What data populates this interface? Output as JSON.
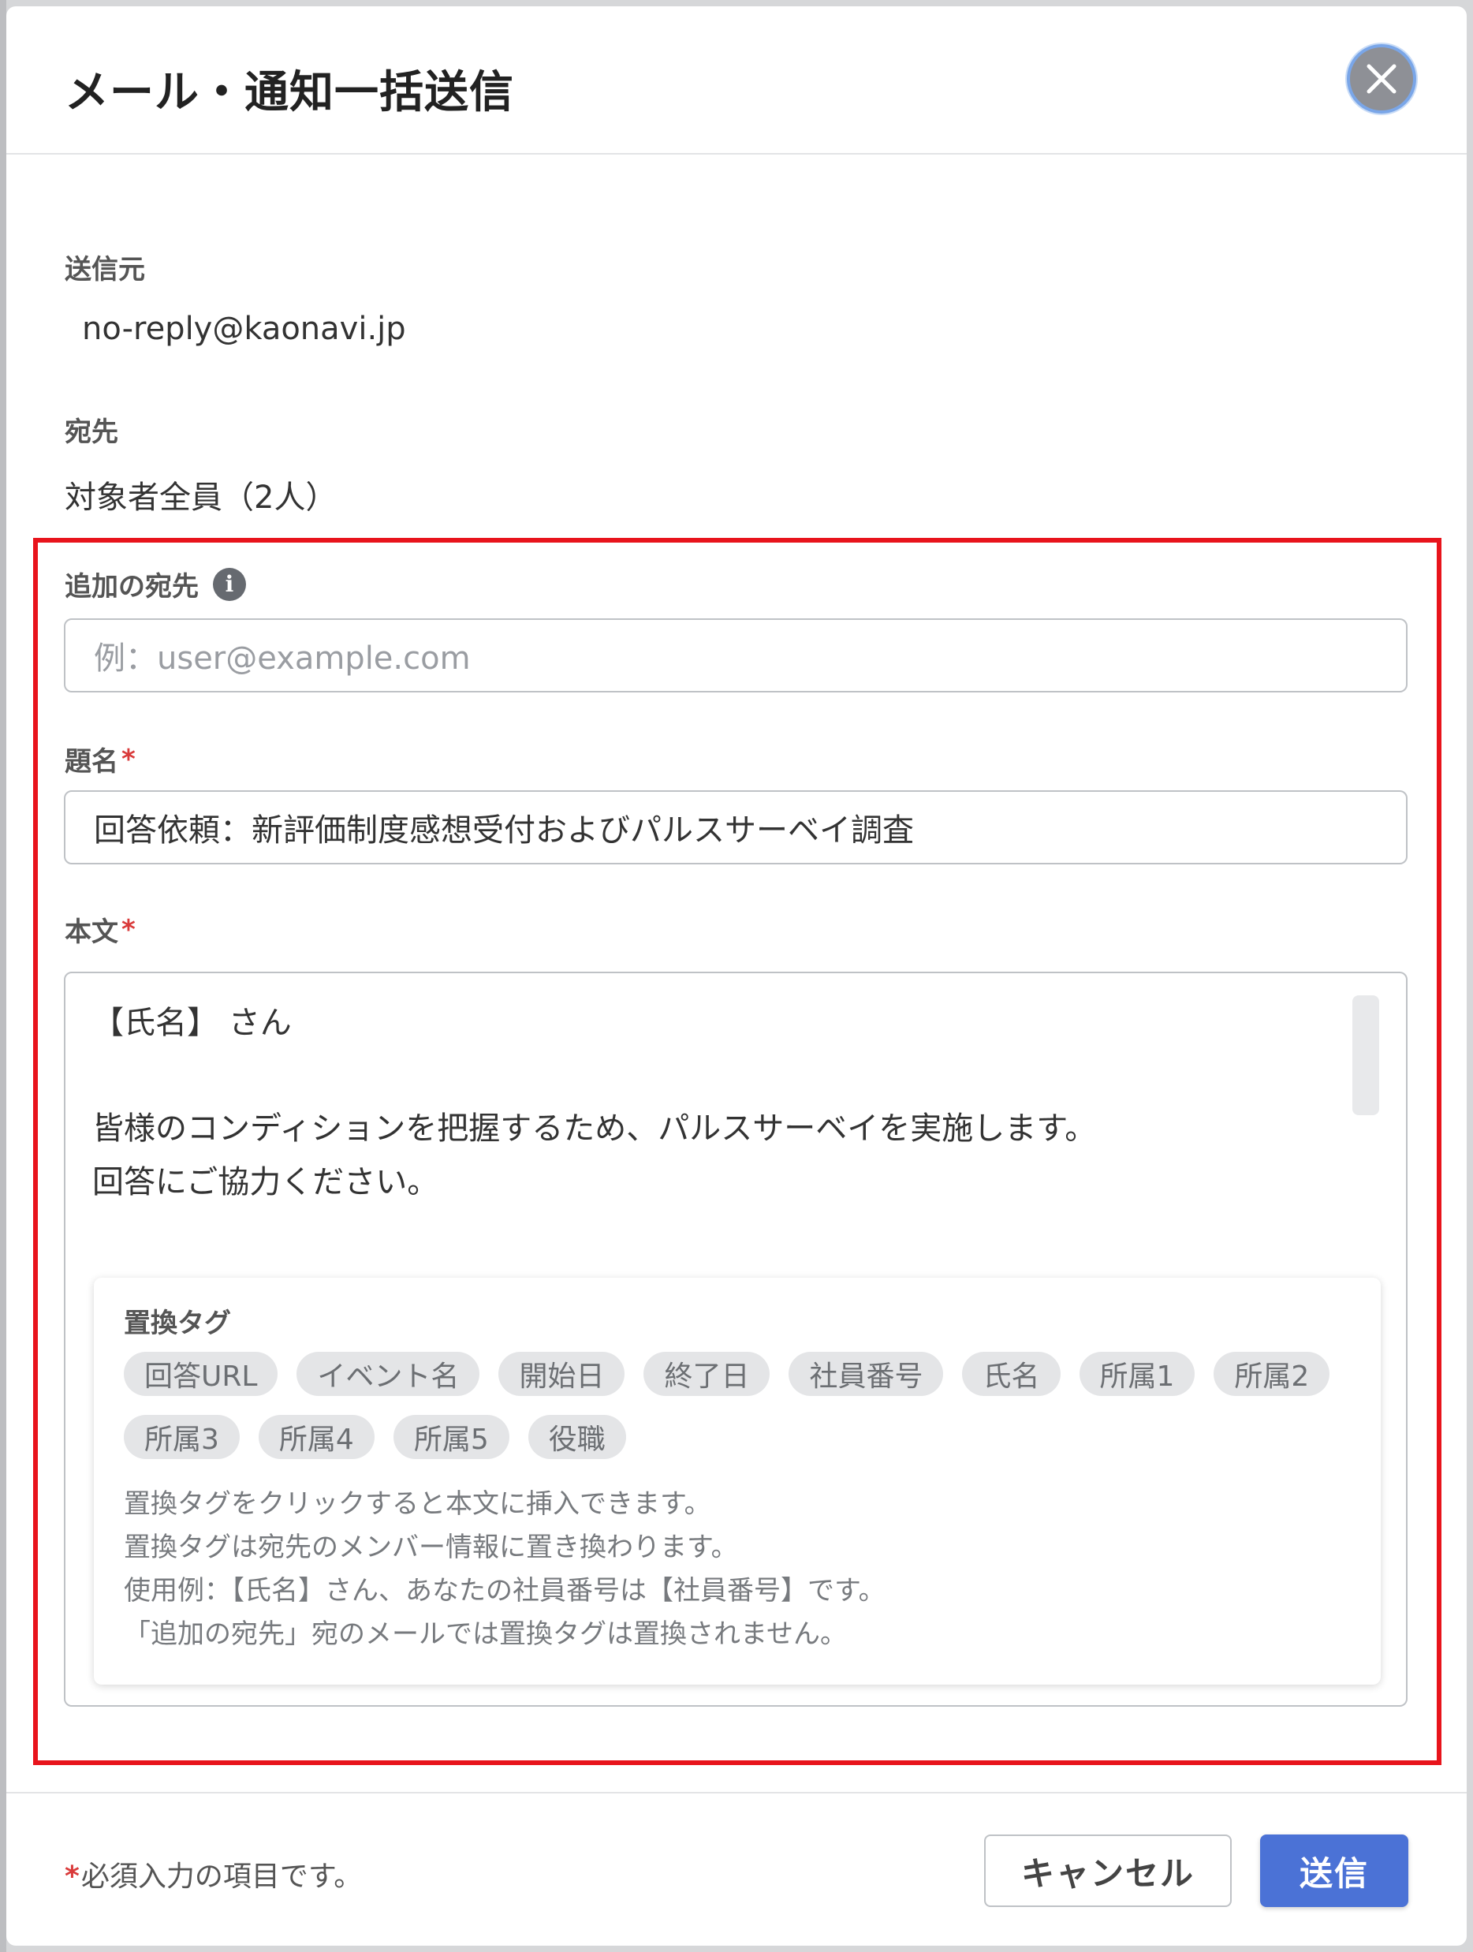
{
  "dialog": {
    "title": "メール・通知一括送信",
    "close_icon": "close-icon"
  },
  "sender": {
    "label": "送信元",
    "value": "no-reply@kaonavi.jp"
  },
  "recipient": {
    "label": "宛先",
    "value": "対象者全員（2人）"
  },
  "additional_recipient": {
    "label": "追加の宛先",
    "info_icon": "info-icon",
    "placeholder": "例：user@example.com"
  },
  "subject": {
    "label": "題名",
    "required_mark": "*",
    "value": "回答依頼：新評価制度感想受付およびパルスサーベイ調査"
  },
  "body": {
    "label": "本文",
    "required_mark": "*",
    "lines": [
      "【氏名】 さん",
      "",
      "皆様のコンディションを把握するため、パルスサーベイを実施します。",
      "回答にご協力ください。"
    ]
  },
  "replacement_tags": {
    "title": "置換タグ",
    "row1": [
      "回答URL",
      "イベント名",
      "開始日",
      "終了日",
      "社員番号",
      "氏名",
      "所属1",
      "所属2"
    ],
    "row2": [
      "所属3",
      "所属4",
      "所属5",
      "役職"
    ],
    "help_lines": [
      "置換タグをクリックすると本文に挿入できます。",
      "置換タグは宛先のメンバー情報に置き換わります。",
      "使用例：【氏名】さん、あなたの社員番号は【社員番号】です。",
      "「追加の宛先」宛のメールでは置換タグは置換されません。"
    ]
  },
  "footer": {
    "required_mark": "*",
    "note": "必須入力の項目です。",
    "cancel_label": "キャンセル",
    "send_label": "送信"
  },
  "colors": {
    "primary": "#4b72d6",
    "required": "#d93a3a",
    "highlight": "#e8141c"
  }
}
